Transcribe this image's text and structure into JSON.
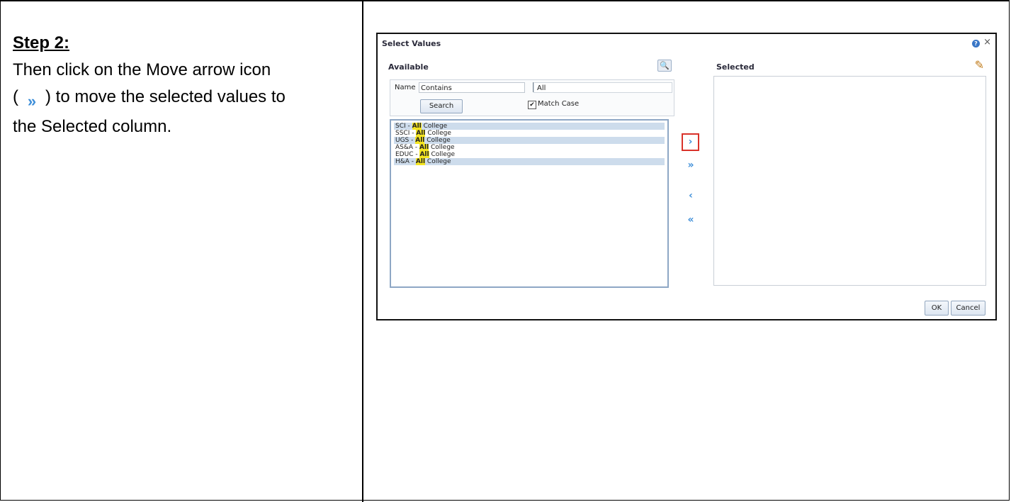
{
  "instructions": {
    "heading": "Step 2:",
    "line1": "Then click on the Move arrow icon",
    "line2_open": "(",
    "inline_icon_glyph": "»",
    "line2_rest": ") to move the selected values to",
    "line3": "the Selected column."
  },
  "dialog": {
    "title": "Select Values",
    "help_glyph": "?",
    "close_glyph": "×",
    "available_label": "Available",
    "binoculars_glyph": "🔍",
    "selected_label": "Selected",
    "edit_glyph": "✎",
    "search": {
      "name_label": "Name",
      "operator": "Contains",
      "operator_arrow": "▼",
      "value": "All",
      "search_button": "Search",
      "match_case_label": "Match Case",
      "match_case_checked": true,
      "check_glyph": "✔"
    },
    "available_items": [
      {
        "prefix": "SCI - ",
        "highlight": "All",
        "suffix": " College"
      },
      {
        "prefix": "SSCI - ",
        "highlight": "All",
        "suffix": " College"
      },
      {
        "prefix": "UGS - ",
        "highlight": "All",
        "suffix": " College"
      },
      {
        "prefix": "AS&A - ",
        "highlight": "All",
        "suffix": " College"
      },
      {
        "prefix": "EDUC - ",
        "highlight": "All",
        "suffix": " College"
      },
      {
        "prefix": "H&A - ",
        "highlight": "All",
        "suffix": " College"
      }
    ],
    "arrows": {
      "move": "›",
      "move_all": "»",
      "remove": "‹",
      "remove_all": "«"
    },
    "ok_button": "OK",
    "cancel_button": "Cancel"
  },
  "colors": {
    "accent_arrow": "#3f8fd9",
    "highlight": "#f4e521",
    "callout_border": "#d9322a"
  }
}
